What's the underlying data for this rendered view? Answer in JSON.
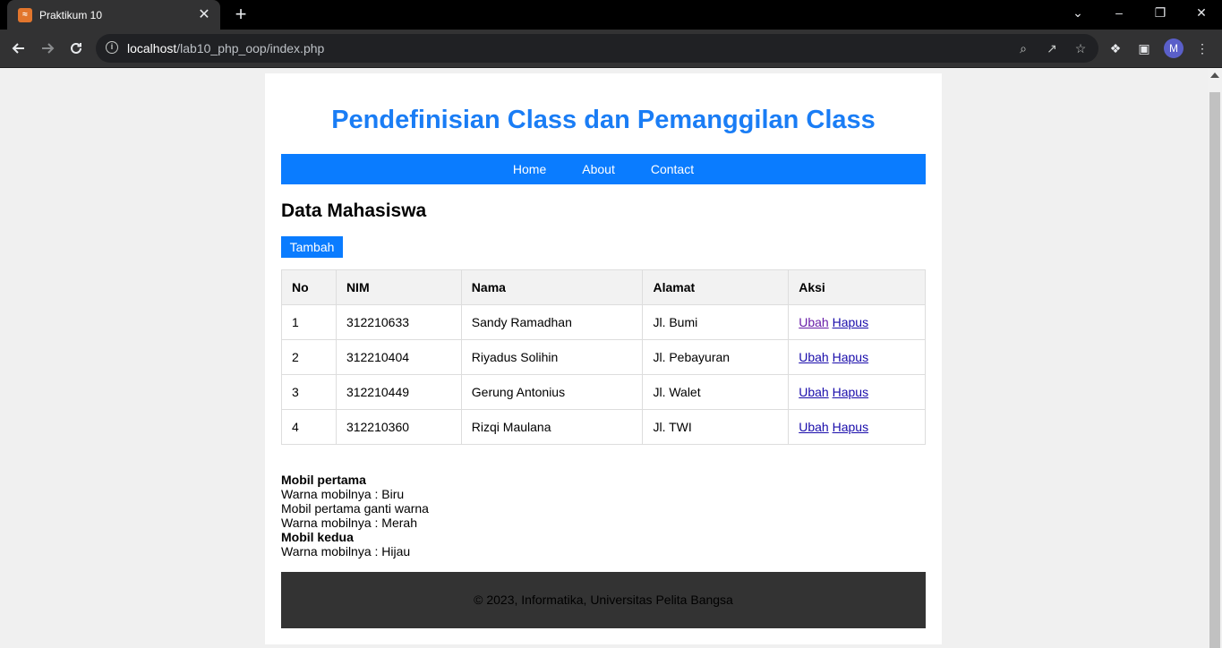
{
  "browser": {
    "tab_title": "Praktikum 10",
    "url_host": "localhost",
    "url_path": "/lab10_php_oop/index.php",
    "profile_initial": "M"
  },
  "page": {
    "title": "Pendefinisian Class dan Pemanggilan Class",
    "nav": [
      "Home",
      "About",
      "Contact"
    ],
    "section_title": "Data Mahasiswa",
    "add_button": "Tambah",
    "table": {
      "headers": [
        "No",
        "NIM",
        "Nama",
        "Alamat",
        "Aksi"
      ],
      "rows": [
        {
          "no": "1",
          "nim": "312210633",
          "nama": "Sandy Ramadhan",
          "alamat": "Jl. Bumi"
        },
        {
          "no": "2",
          "nim": "312210404",
          "nama": "Riyadus Solihin",
          "alamat": "Jl. Pebayuran"
        },
        {
          "no": "3",
          "nim": "312210449",
          "nama": "Gerung Antonius",
          "alamat": "Jl. Walet"
        },
        {
          "no": "4",
          "nim": "312210360",
          "nama": "Rizqi Maulana",
          "alamat": "Jl. TWI"
        }
      ],
      "edit_label": "Ubah",
      "delete_label": "Hapus"
    },
    "output_lines": [
      {
        "text": "Mobil pertama",
        "bold": true
      },
      {
        "text": "Warna mobilnya : Biru",
        "bold": false
      },
      {
        "text": "Mobil pertama ganti warna",
        "bold": false
      },
      {
        "text": "Warna mobilnya : Merah",
        "bold": false
      },
      {
        "text": "Mobil kedua",
        "bold": true
      },
      {
        "text": "Warna mobilnya : Hijau",
        "bold": false
      }
    ],
    "footer": "© 2023, Informatika, Universitas Pelita Bangsa"
  },
  "colors": {
    "accent": "#0a7cff",
    "title": "#1a7df5",
    "footer_bg": "#333333"
  }
}
